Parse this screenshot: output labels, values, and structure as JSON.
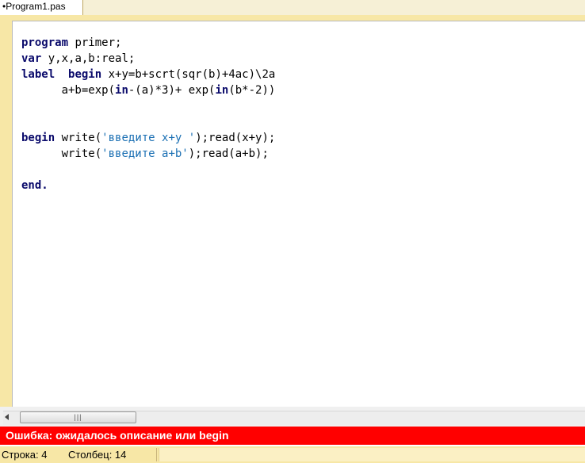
{
  "tab": {
    "label": "•Program1.pas"
  },
  "code": {
    "lines": [
      [
        {
          "t": "program",
          "k": 1
        },
        {
          "t": " primer;"
        }
      ],
      [
        {
          "t": "var",
          "k": 1
        },
        {
          "t": " y,x,a,b:real;"
        }
      ],
      [
        {
          "t": "label",
          "k": 1
        },
        {
          "t": "  "
        },
        {
          "t": "begin",
          "k": 1
        },
        {
          "t": " x+y=b+scrt(sqr(b)+4ac)\\2a"
        }
      ],
      [
        {
          "t": "      a+b=exp("
        },
        {
          "t": "in",
          "k": 1
        },
        {
          "t": "-(a)*3)+ exp("
        },
        {
          "t": "in",
          "k": 1
        },
        {
          "t": "(b*-2))"
        }
      ],
      [
        {
          "t": ""
        }
      ],
      [
        {
          "t": ""
        }
      ],
      [
        {
          "t": "begin",
          "k": 1
        },
        {
          "t": " write("
        },
        {
          "t": "'введите x+y '",
          "s": 1
        },
        {
          "t": ");read(x+y);"
        }
      ],
      [
        {
          "t": "      write("
        },
        {
          "t": "'введите a+b'",
          "s": 1
        },
        {
          "t": ");read(a+b);"
        }
      ],
      [
        {
          "t": ""
        }
      ],
      [
        {
          "t": "end.",
          "k": 1
        }
      ]
    ]
  },
  "scrollbar": {
    "grip": "|||"
  },
  "error": {
    "message": "Ошибка: ожидалось описание или begin"
  },
  "status": {
    "row": "Строка: 4",
    "column": "Столбец: 14"
  },
  "colors": {
    "error_bg": "#ff0000",
    "frame_bg": "#f7e7a6",
    "keyword": "#0a0a6b",
    "string": "#1a6fb3"
  }
}
